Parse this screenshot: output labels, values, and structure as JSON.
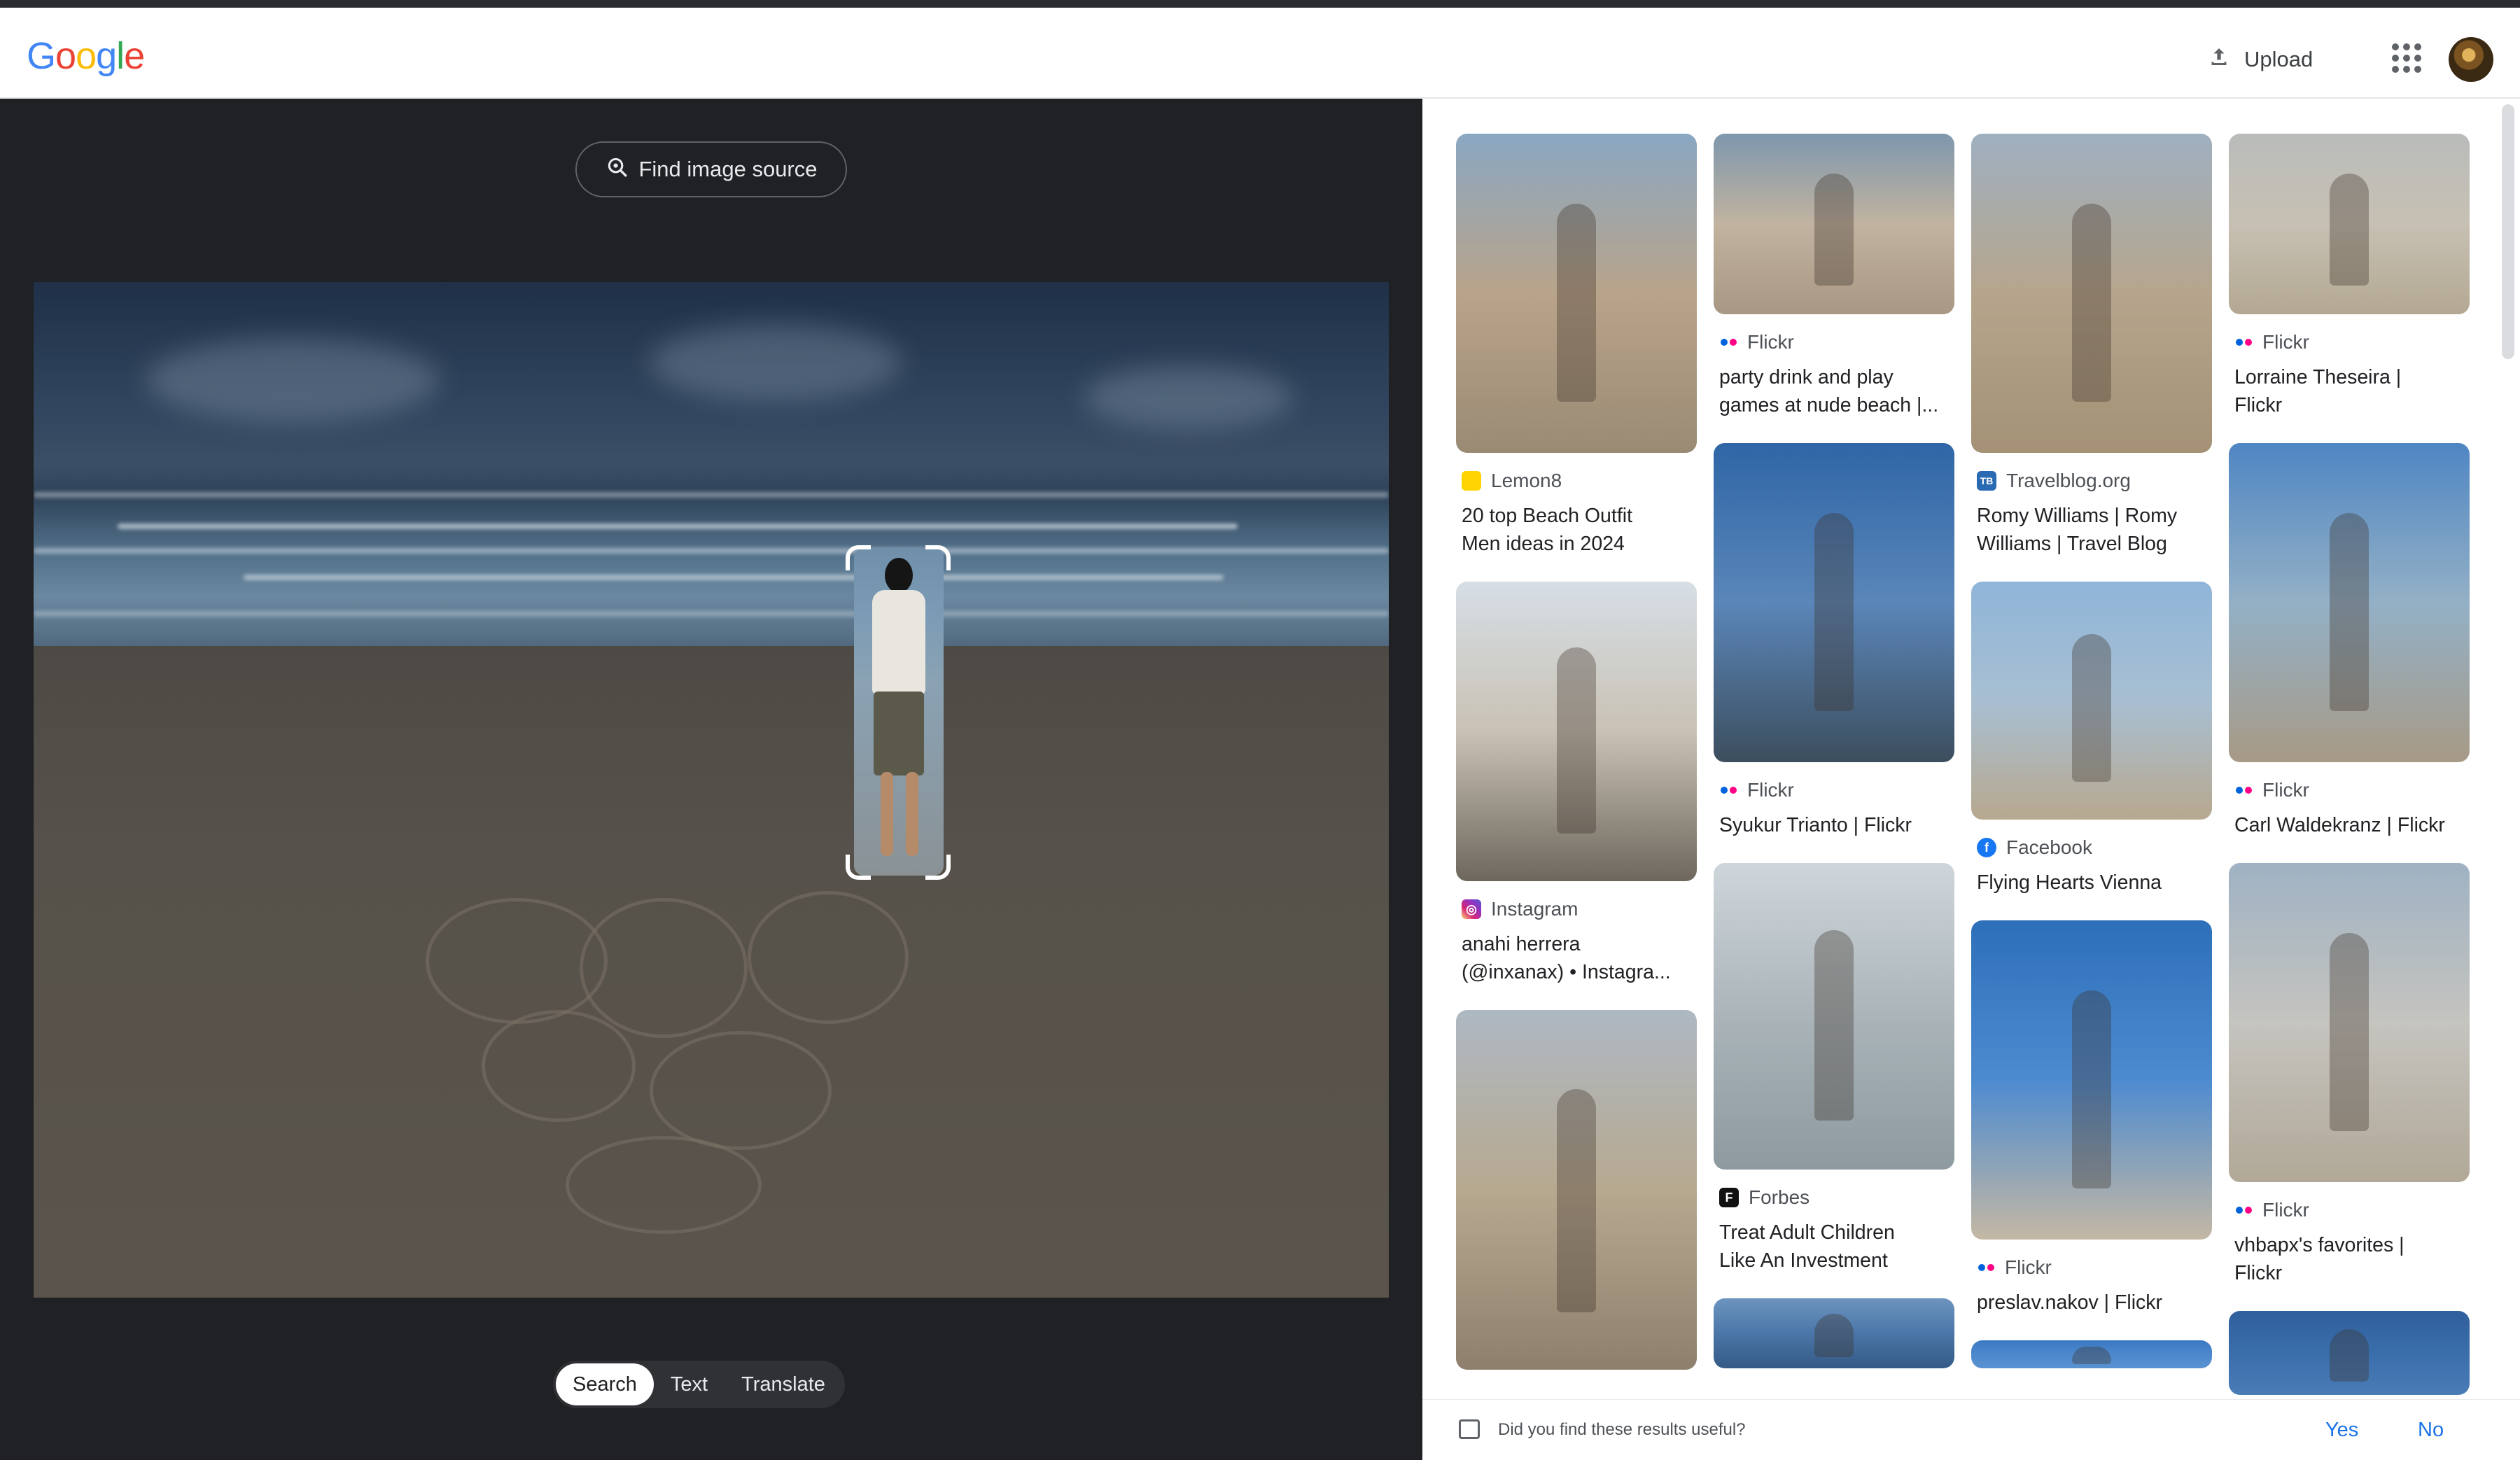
{
  "header": {
    "logo_letters": [
      {
        "ch": "G",
        "color": "#4285F4"
      },
      {
        "ch": "o",
        "color": "#EA4335"
      },
      {
        "ch": "o",
        "color": "#FBBC05"
      },
      {
        "ch": "g",
        "color": "#4285F4"
      },
      {
        "ch": "l",
        "color": "#34A853"
      },
      {
        "ch": "e",
        "color": "#EA4335"
      }
    ],
    "upload_label": "Upload",
    "upload_icon": "upload-icon",
    "apps_icon": "apps-grid-icon"
  },
  "viewer": {
    "find_source_label": "Find image source",
    "find_source_icon": "lens-search-icon",
    "tabs": [
      {
        "label": "Search",
        "active": true
      },
      {
        "label": "Text",
        "active": false
      },
      {
        "label": "Translate",
        "active": false
      }
    ]
  },
  "results": {
    "columns": [
      [
        {
          "source": "Lemon8",
          "source_icon": "lemon8",
          "title_lines": [
            "20 top Beach Outfit",
            "Men ideas in 2024"
          ],
          "thumb_colors": [
            "#8aa7c2",
            "#b9a48a",
            "#9a8a74"
          ]
        },
        {
          "source": "Instagram",
          "source_icon": "instagram",
          "title_lines": [
            "anahi herrera",
            "(@inxanax) • Instagra..."
          ],
          "thumb_colors": [
            "#d6dee6",
            "#c9c2b4",
            "#6e675d"
          ]
        },
        {
          "source": "",
          "source_icon": "",
          "title_lines": [],
          "thumb_colors": [
            "#aeb8c2",
            "#b7a990",
            "#8e7f6c"
          ]
        }
      ],
      [
        {
          "source": "Flickr",
          "source_icon": "flickr",
          "title_lines": [
            "party drink and play",
            "games at nude beach |..."
          ],
          "thumb_colors": [
            "#7e97ad",
            "#c1b3a0",
            "#a89783"
          ]
        },
        {
          "source": "Flickr",
          "source_icon": "flickr",
          "title_lines": [
            "Syukur Trianto | Flickr"
          ],
          "thumb_colors": [
            "#2f66a6",
            "#5a86b9",
            "#3c4e5e"
          ]
        },
        {
          "source": "Forbes",
          "source_icon": "forbes",
          "title_lines": [
            "Treat Adult Children",
            "Like An Investment"
          ],
          "thumb_colors": [
            "#cfd6db",
            "#aab4b9",
            "#8d9aa0"
          ]
        },
        {
          "source": "",
          "source_icon": "",
          "title_lines": [],
          "thumb_colors": [
            "#6d94bf",
            "#4a76a8",
            "#355a86"
          ]
        }
      ],
      [
        {
          "source": "Travelblog.org",
          "source_icon": "travelblog",
          "title_lines": [
            "Romy Williams | Romy",
            "Williams | Travel Blog"
          ],
          "thumb_colors": [
            "#9fb0c0",
            "#b6a58c",
            "#a49176"
          ]
        },
        {
          "source": "Facebook",
          "source_icon": "facebook",
          "title_lines": [
            "Flying Hearts Vienna"
          ],
          "thumb_colors": [
            "#8fb5d9",
            "#a8bfd2",
            "#b7a88f"
          ]
        },
        {
          "source": "Flickr",
          "source_icon": "flickr",
          "title_lines": [
            "preslav.nakov | Flickr"
          ],
          "thumb_colors": [
            "#2d6fb9",
            "#4d8bd0",
            "#c4b8a4"
          ]
        },
        {
          "source": "",
          "source_icon": "",
          "title_lines": [],
          "thumb_colors": [
            "#3b78c2",
            "#4d88cc",
            "#5a92d1"
          ]
        }
      ],
      [
        {
          "source": "Flickr",
          "source_icon": "flickr",
          "title_lines": [
            "Lorraine Theseira |",
            "Flickr"
          ],
          "thumb_colors": [
            "#b9bcbb",
            "#c7c0b3",
            "#b3a892"
          ]
        },
        {
          "source": "Flickr",
          "source_icon": "flickr",
          "title_lines": [
            "Carl Waldekranz | Flickr"
          ],
          "thumb_colors": [
            "#4f86c3",
            "#93b0c6",
            "#a79a86"
          ]
        },
        {
          "source": "Flickr",
          "source_icon": "flickr",
          "title_lines": [
            "vhbapx's favorites |",
            "Flickr"
          ],
          "thumb_colors": [
            "#9fb2c3",
            "#c5c4bf",
            "#b1a897"
          ]
        },
        {
          "source": "",
          "source_icon": "",
          "title_lines": [],
          "thumb_colors": [
            "#2f5f9c",
            "#3a6eab",
            "#4a7cb6"
          ]
        }
      ]
    ]
  },
  "feedback": {
    "question": "Did you find these results useful?",
    "yes_label": "Yes",
    "no_label": "No",
    "icon": "feedback-icon"
  },
  "colors": {
    "link_blue": "#1a73e8",
    "dark_panel": "#202124",
    "flickr_blue": "#0063DC",
    "flickr_pink": "#FF0084"
  }
}
